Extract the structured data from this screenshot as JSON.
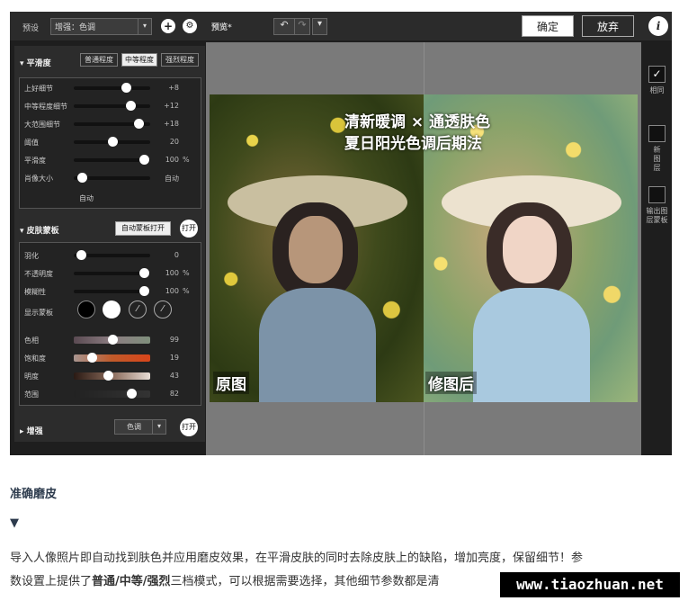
{
  "topbar": {
    "preset_label": "预设",
    "preset_value": "增强：色调",
    "add_symbol": "+",
    "gear_symbol": "⚙",
    "preview_label": "预览*",
    "undo_symbol": "↶",
    "redo_symbol": "↷",
    "more_symbol": "▾",
    "ok_label": "确定",
    "cancel_label": "放弃",
    "info_symbol": "i"
  },
  "smooth": {
    "header": "平滑度",
    "modes": [
      {
        "label": "普通程度",
        "active": false
      },
      {
        "label": "中等程度",
        "active": true
      },
      {
        "label": "强烈程度",
        "active": false
      }
    ],
    "sliders": [
      {
        "label": "上好细节",
        "value": "+8",
        "unit": "",
        "level": 0.72
      },
      {
        "label": "中等程度细节",
        "value": "+12",
        "unit": "",
        "level": 0.78
      },
      {
        "label": "大范围细节",
        "value": "+18",
        "unit": "",
        "level": 0.9
      },
      {
        "label": "阈值",
        "value": "20",
        "unit": "",
        "level": 0.52
      },
      {
        "label": "平滑度",
        "value": "100",
        "unit": "%",
        "level": 0.98
      },
      {
        "label": "肖像大小",
        "value": "自动",
        "unit": "",
        "level": 0.05
      }
    ],
    "auto_note": "自动"
  },
  "skin": {
    "header": "皮肤蒙板",
    "auto_mask_label": "自动蒙板打开",
    "toggle_label": "打开",
    "sliders": [
      {
        "label": "羽化",
        "value": "0",
        "unit": "",
        "level": 0.04
      },
      {
        "label": "不透明度",
        "value": "100",
        "unit": "%",
        "level": 0.98
      },
      {
        "label": "模糊性",
        "value": "100",
        "unit": "%",
        "level": 0.98
      }
    ],
    "show_mask_label": "显示蒙板",
    "color_sliders": [
      {
        "label": "色相",
        "value": "99",
        "level": 0.52,
        "gradient": "linear-gradient(90deg,#5a4a52,#8c7d82,#7f8f7c)"
      },
      {
        "label": "饱和度",
        "value": "19",
        "level": 0.2,
        "gradient": "linear-gradient(90deg,#a89590,#c05a2a,#d8451a)"
      },
      {
        "label": "明度",
        "value": "43",
        "level": 0.45,
        "gradient": "linear-gradient(90deg,#2a1a14,#8a6a5a,#e8ddd5)"
      },
      {
        "label": "范围",
        "value": "82",
        "level": 0.8,
        "gradient": "linear-gradient(90deg,#222,#333)"
      }
    ]
  },
  "enhance": {
    "header": "增强",
    "select_value": "色调",
    "toggle_label": "打开"
  },
  "preview": {
    "headline1": "清新暖调 × 通透肤色",
    "headline2": "夏日阳光色调后期法",
    "left_tag": "原图",
    "right_tag": "修图后"
  },
  "rightbar": {
    "same_label": "相同",
    "new_layer_label": "新图层",
    "export_mask_label": "输出图层蒙板"
  },
  "article": {
    "title": "准确磨皮",
    "arrow": "▼",
    "para1": "导入人像照片即自动找到肤色并应用磨皮效果，在平滑皮肤的同时去除皮肤上的缺陷，增加亮度，保留细节！参",
    "para2_a": "数设置上提供了",
    "para2_b": "普通/中等/强烈",
    "para2_c": "三档模式，可以根据需要选择，其他细节参数都是清"
  },
  "watermark": "www.tiaozhuan.net"
}
